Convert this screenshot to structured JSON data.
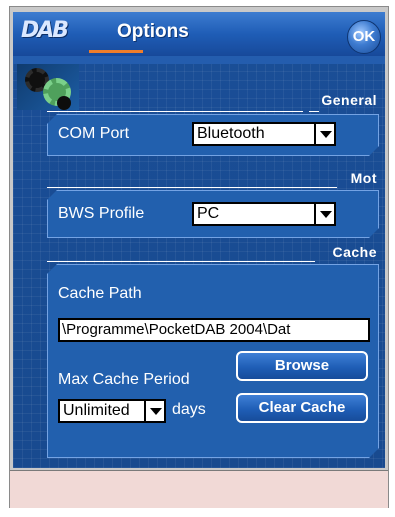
{
  "titlebar": {
    "logo": "DAB",
    "title": "Options",
    "ok_label": "OK"
  },
  "general": {
    "section_title": "General",
    "com_port_label": "COM Port",
    "com_port_value": "Bluetooth"
  },
  "mot": {
    "section_title": "Mot",
    "bws_profile_label": "BWS Profile",
    "bws_profile_value": "PC"
  },
  "cache": {
    "section_title": "Cache",
    "cache_path_label": "Cache Path",
    "cache_path_value": "\\Programme\\PocketDAB 2004\\Dat",
    "max_period_label": "Max Cache Period",
    "period_value": "Unlimited",
    "period_unit": "days",
    "browse_label": "Browse",
    "clear_label": "Clear Cache"
  },
  "colors": {
    "background": "#1b4f96",
    "titlebar": "#1f5db6",
    "accent": "#ef7d2a",
    "footer": "#f1d9d6"
  }
}
